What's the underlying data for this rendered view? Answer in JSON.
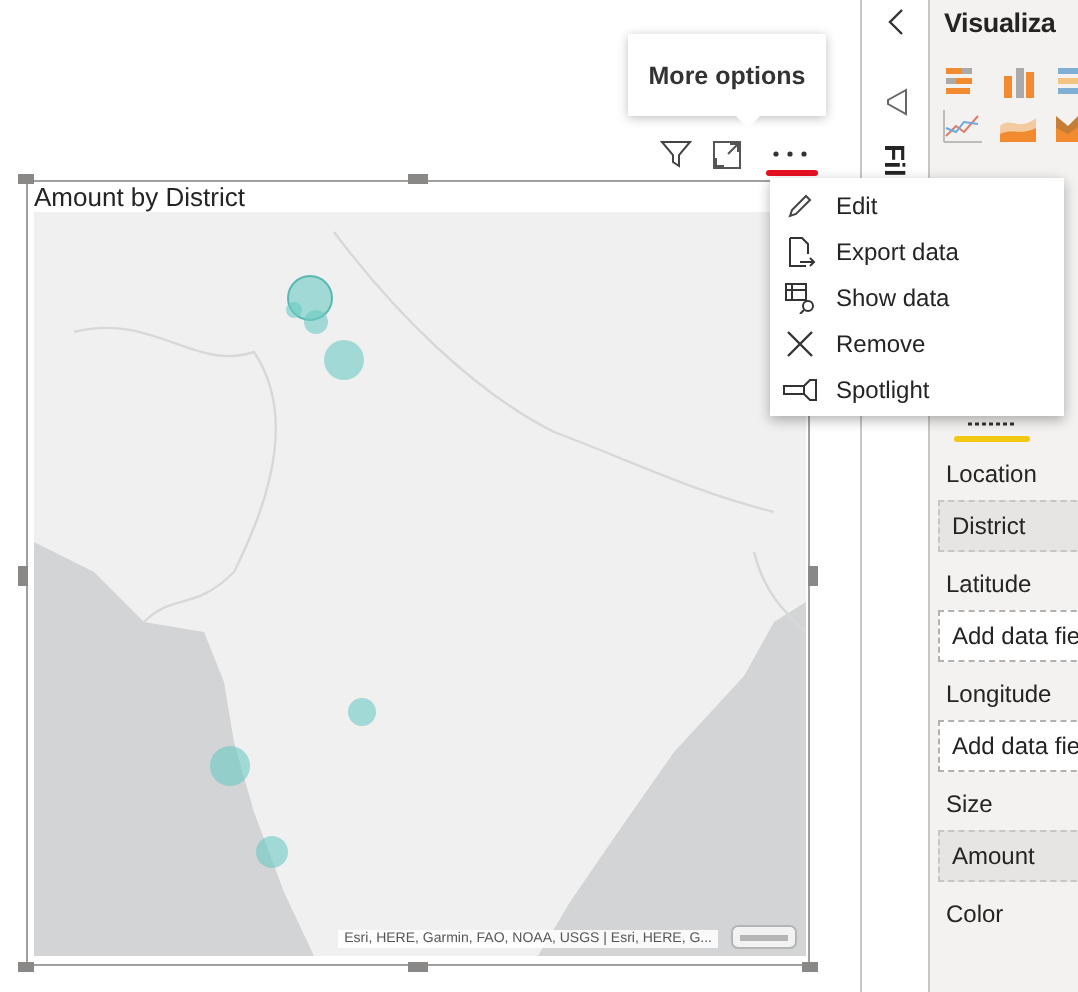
{
  "tooltip": {
    "text": "More options"
  },
  "visual_header": {
    "more_options_highlighted": true
  },
  "visual": {
    "title": "Amount by District",
    "attribution": "Esri, HERE, Garmin, FAO, NOAA, USGS | Esri, HERE, G..."
  },
  "context_menu": {
    "items": [
      {
        "label": "Edit"
      },
      {
        "label": "Export data"
      },
      {
        "label": "Show data"
      },
      {
        "label": "Remove"
      },
      {
        "label": "Spotlight"
      }
    ]
  },
  "filters_pane": {
    "label": "Fil"
  },
  "visualizations_pane": {
    "title": "Visualiza"
  },
  "fields": [
    {
      "label": "Location",
      "value": "District"
    },
    {
      "label": "Latitude",
      "placeholder": "Add data fie"
    },
    {
      "label": "Longitude",
      "placeholder": "Add data fie"
    },
    {
      "label": "Size",
      "value": "Amount"
    },
    {
      "label": "Color"
    }
  ]
}
